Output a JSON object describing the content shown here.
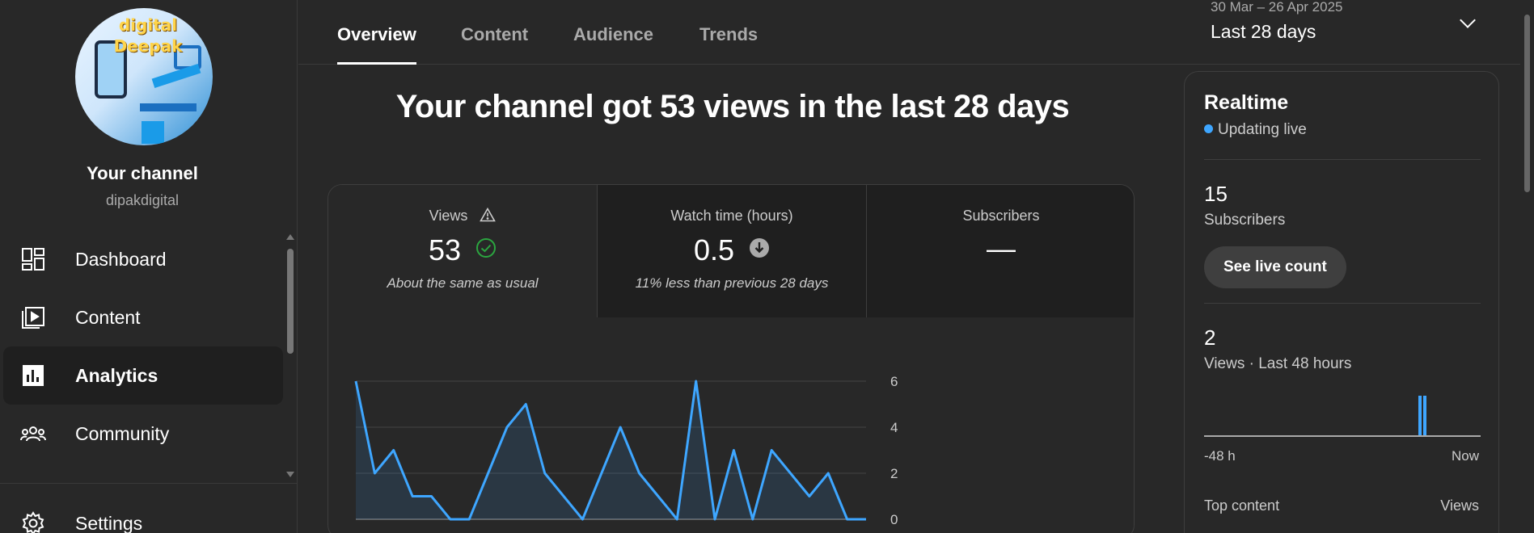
{
  "sidebar": {
    "channel_title": "Your channel",
    "channel_handle": "dipakdigital",
    "avatar_text": "digital Deepak",
    "items": [
      {
        "label": "Dashboard",
        "icon": "dashboard-icon"
      },
      {
        "label": "Content",
        "icon": "content-icon"
      },
      {
        "label": "Analytics",
        "icon": "analytics-icon",
        "active": true
      },
      {
        "label": "Community",
        "icon": "community-icon"
      },
      {
        "label": "Settings",
        "icon": "settings-icon"
      }
    ]
  },
  "tabs": [
    "Overview",
    "Content",
    "Audience",
    "Trends"
  ],
  "date_range": {
    "range": "30 Mar – 26 Apr 2025",
    "label": "Last 28 days"
  },
  "headline": "Your channel got 53 views in the last 28 days",
  "metrics": [
    {
      "label": "Views",
      "value": "53",
      "sub": "About the same as usual",
      "status": "normal"
    },
    {
      "label": "Watch time (hours)",
      "value": "0.5",
      "sub": "11% less than previous 28 days",
      "status": "down"
    },
    {
      "label": "Subscribers",
      "value": "—",
      "sub": ""
    }
  ],
  "chart_data": {
    "type": "area",
    "x": [
      1,
      2,
      3,
      4,
      5,
      6,
      7,
      8,
      9,
      10,
      11,
      12,
      13,
      14,
      15,
      16,
      17,
      18,
      19,
      20,
      21,
      22,
      23,
      24,
      25,
      26,
      27,
      28
    ],
    "values": [
      6,
      2,
      3,
      1,
      1,
      0,
      0,
      2,
      4,
      5,
      2,
      1,
      0,
      2,
      4,
      2,
      1,
      0,
      6,
      0,
      3,
      0,
      3,
      2,
      1,
      2,
      0,
      0
    ],
    "yticks": [
      "0",
      "2",
      "4",
      "6"
    ],
    "ylim": [
      0,
      6
    ],
    "grid": true,
    "line_color": "#3ea6ff"
  },
  "realtime": {
    "title": "Realtime",
    "live_label": "Updating live",
    "subscribers_value": "15",
    "subscribers_label": "Subscribers",
    "button_label": "See live count",
    "views_value": "2",
    "views_label": "Views · Last 48 hours",
    "axis_left": "-48 h",
    "axis_right": "Now",
    "top_content_label": "Top content",
    "views_col_label": "Views"
  },
  "colors": {
    "accent": "#3ea6ff",
    "background": "#282828",
    "check": "#2ba640"
  }
}
